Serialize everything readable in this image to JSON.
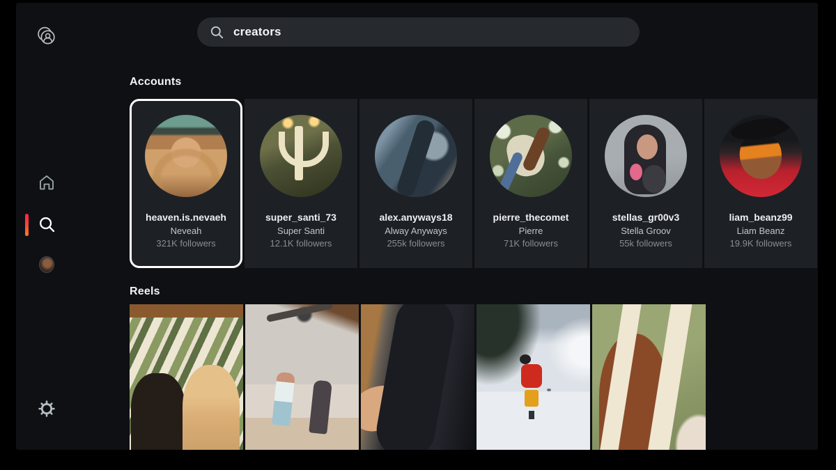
{
  "search": {
    "query": "creators",
    "icon": "search-icon"
  },
  "sidebar": {
    "icons": [
      {
        "name": "account-switcher-icon"
      },
      {
        "name": "home-icon"
      },
      {
        "name": "search-icon",
        "active": true
      },
      {
        "name": "profile-avatar",
        "photo": "small circular profile photo of a person"
      },
      {
        "name": "settings-gear-icon"
      }
    ],
    "active_indicator_colors": [
      "#ff1f4f",
      "#ff7f2a"
    ]
  },
  "accounts": {
    "heading": "Accounts",
    "items": [
      {
        "username": "heaven.is.nevaeh",
        "display_name": "Neveah",
        "followers": "321K followers",
        "selected": true,
        "photo": "upside-down face with long blonde hair, teal background"
      },
      {
        "username": "super_santi_73",
        "display_name": "Super Santi",
        "followers": "12.1K followers",
        "selected": false,
        "photo": "person behind white candelabra with lit candles, olive tones"
      },
      {
        "username": "alex.anyways18",
        "display_name": "Alway Anyways",
        "followers": "255k followers",
        "selected": false,
        "photo": "blurry blue-gray close-up of a person covering face"
      },
      {
        "username": "pierre_thecomet",
        "display_name": "Pierre",
        "followers": "71K followers",
        "selected": false,
        "photo": "man in white 85 jersey sitting in a leafy tree"
      },
      {
        "username": "stellas_gr00v3",
        "display_name": "Stella Groov",
        "followers": "55k followers",
        "selected": false,
        "photo": "dark-haired girl in striped shirt holding pink phone"
      },
      {
        "username": "liam_beanz99",
        "display_name": "Liam Beanz",
        "followers": "19.9K followers",
        "selected": false,
        "photo": "man with braids and orange sunglasses wearing red jacket"
      }
    ]
  },
  "reels": {
    "heading": "Reels",
    "items": [
      {
        "photo": "two girls taking a mirror selfie with a camera in front of green patterned curtains"
      },
      {
        "photo": "two people dancing in a bedroom with a ceiling fan"
      },
      {
        "photo": "dark close-up of a person in black with outstretched hand"
      },
      {
        "photo": "skier in red jacket and yellow pants on a snowy slope"
      },
      {
        "photo": "red-haired person behind white sculpture prongs on green wall"
      }
    ]
  },
  "colors": {
    "frame": "#000000",
    "app_background": "#0e1013",
    "card_background": "#1d2125",
    "search_pill": "#26292e",
    "selected_border": "#ffffff",
    "text_primary": "#eef0f2",
    "text_secondary": "#c3c7cb",
    "text_muted": "#868d94"
  }
}
